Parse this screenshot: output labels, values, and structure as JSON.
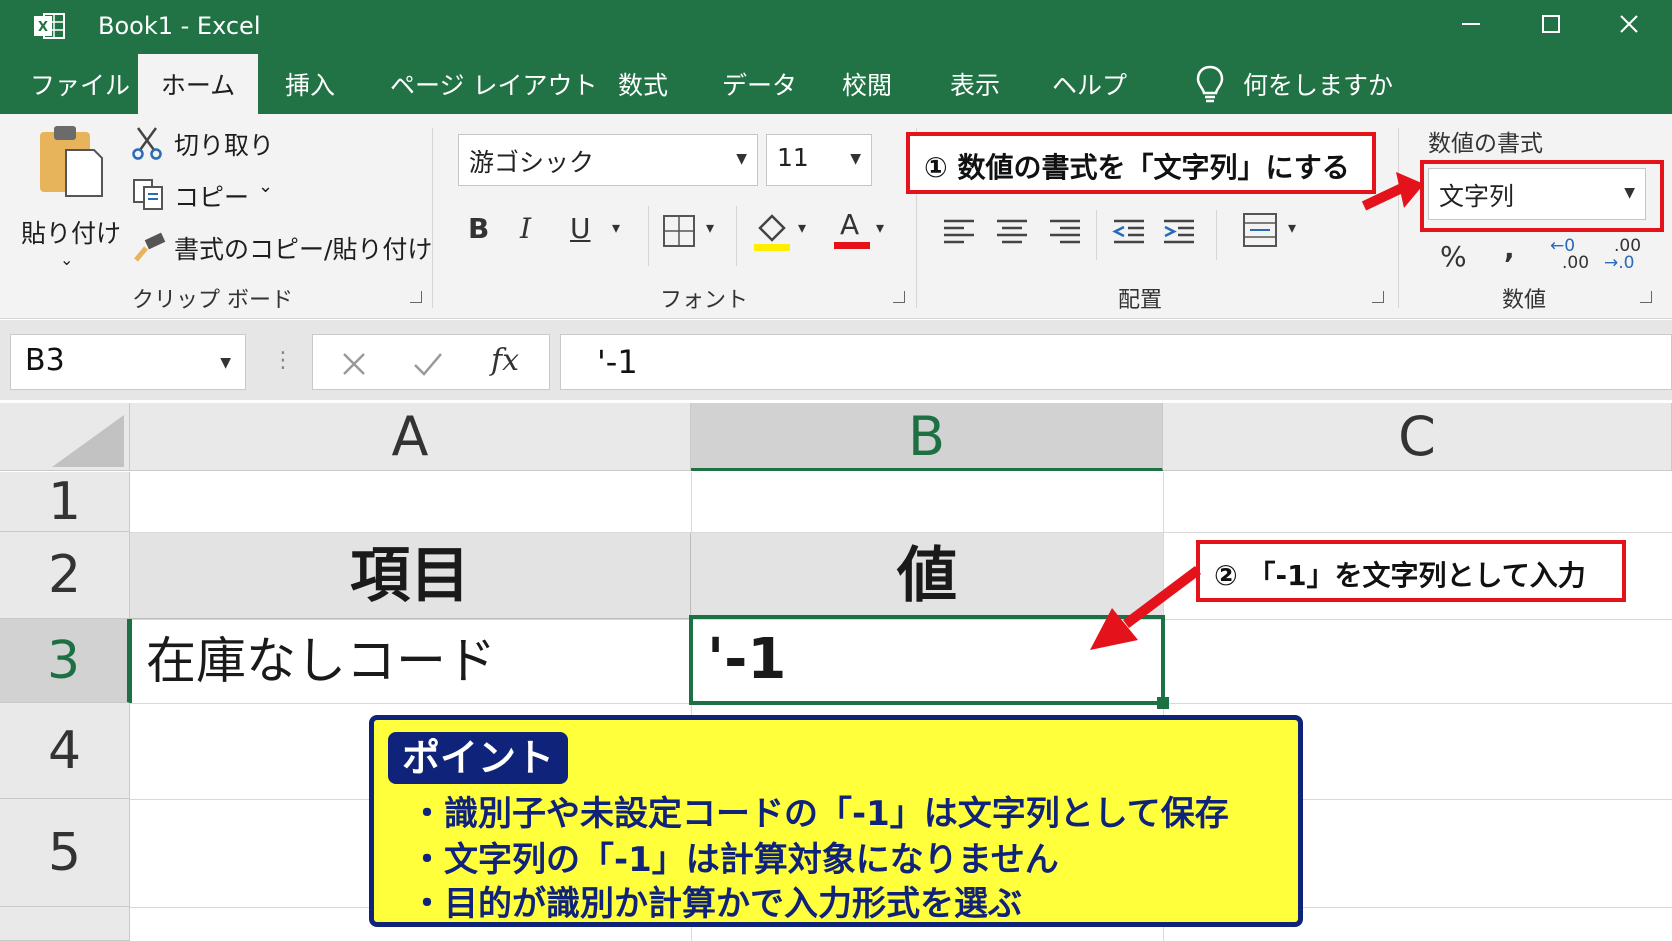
{
  "window": {
    "title": "Book1  -  Excel",
    "app_icon": "excel-logo-icon"
  },
  "tabs": [
    "ファイル",
    "ホーム",
    "挿入",
    "ページ レイアウト",
    "数式",
    "データ",
    "校閲",
    "表示",
    "ヘルプ"
  ],
  "active_tab": "ホーム",
  "tell_me": "何をしますか",
  "clipboard": {
    "paste": "貼り付け",
    "cut": "切り取り",
    "copy": "コピー",
    "format_painter": "書式のコピー/貼り付け",
    "group": "クリップ ボード"
  },
  "font": {
    "name": "游ゴシック",
    "size": "11",
    "bold": "B",
    "italic": "I",
    "underline": "U",
    "font_color": "A",
    "group": "フォント"
  },
  "alignment": {
    "group": "配置"
  },
  "number": {
    "label": "数値の書式",
    "format": "文字列",
    "percent": "%",
    "comma": ",",
    "inc_decimal_top": "←0",
    "inc_decimal_bottom": ".00",
    "dec_decimal_top": ".00",
    "dec_decimal_bottom": "→.0",
    "group": "数値"
  },
  "callouts": {
    "step1": "① 数値の書式を「文字列」にする",
    "step2": "② 「-1」を文字列として入力"
  },
  "formula_bar": {
    "name_box": "B3",
    "fx": "fx",
    "content": "'-1"
  },
  "columns": [
    "A",
    "B",
    "C"
  ],
  "rows": [
    "1",
    "2",
    "3",
    "4",
    "5"
  ],
  "cells": {
    "A2": "項目",
    "B2": "値",
    "A3": "在庫なしコード",
    "B3": "'-1"
  },
  "point": {
    "title": "ポイント",
    "items": [
      "・識別子や未設定コードの「-1」は文字列として保存",
      "・文字列の「-1」は計算対象になりません",
      "・目的が識別か計算かで入力形式を選ぶ"
    ]
  },
  "colors": {
    "excel_green": "#217346",
    "callout_red": "#e3121b",
    "point_yellow": "#ffff3c",
    "point_navy": "#10237a",
    "selected_cell_border": "#1d7044"
  }
}
